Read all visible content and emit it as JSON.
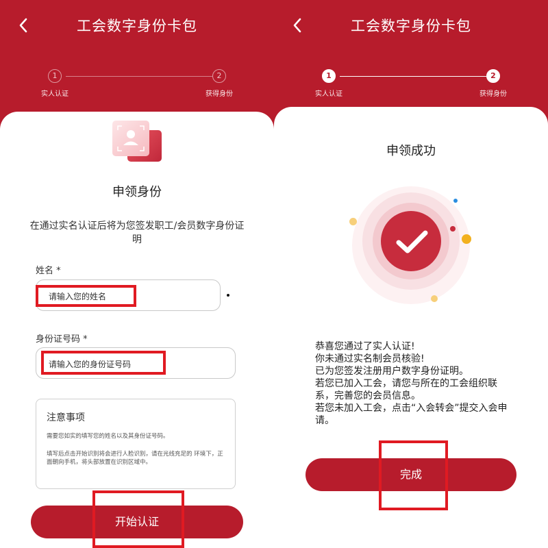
{
  "left_screen": {
    "title": "工会数字身份卡包",
    "steps": [
      {
        "number": "1",
        "label": "实人认证"
      },
      {
        "number": "2",
        "label": "获得身份"
      }
    ],
    "section_title": "申领身份",
    "description": "在通过实名认证后将为您签发职工/会员数字身份证明",
    "name_field": {
      "label": "姓名 *",
      "placeholder": "请输入您的姓名"
    },
    "id_field": {
      "label": "身份证号码 *",
      "placeholder": "请输入您的身份证号码"
    },
    "notice": {
      "title": "注意事项",
      "paragraph1": "需要您如实的填写您的姓名以及其身份证号码。",
      "paragraph2": "填写后点击开始识别将会进行人脸识别，请在光线充足的 环境下，正面朝向手机，将头部放置在识别区域中。"
    },
    "start_button": "开始认证"
  },
  "right_screen": {
    "title": "工会数字身份卡包",
    "steps": [
      {
        "number": "1",
        "label": "实人认证"
      },
      {
        "number": "2",
        "label": "获得身份"
      }
    ],
    "success_title": "申领成功",
    "message_lines": [
      "恭喜您通过了实人认证!",
      "你未通过实名制会员核验!",
      "已为您签发注册用户数字身份证明。",
      "若您已加入工会，请您与所在的工会组织联系，完善您的会员信息。",
      "若您未加入工会，点击“入会转会”提交入会申请。"
    ],
    "done_button": "完成"
  },
  "icons": {
    "back": "chevron-left-icon",
    "id_card": "id-card-icon",
    "success": "checkmark-icon"
  },
  "colors": {
    "brand_red": "#b71c2c",
    "highlight_red": "#e01a22",
    "white": "#ffffff"
  }
}
